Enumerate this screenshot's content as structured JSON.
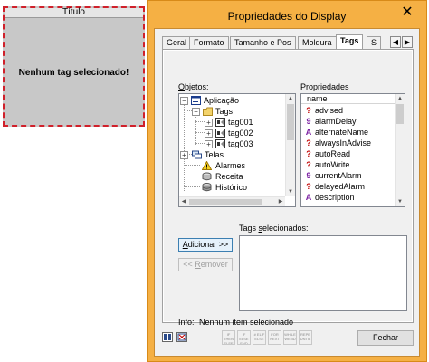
{
  "preview": {
    "title": "Título",
    "message": "Nenhum tag selecionado!"
  },
  "window": {
    "title": "Propriedades do Display",
    "close_glyph": "✕"
  },
  "tabs": [
    {
      "label": "Geral"
    },
    {
      "label": "Formato"
    },
    {
      "label": "Tamanho e Pos"
    },
    {
      "label": "Moldura"
    },
    {
      "label": "Tags"
    },
    {
      "label": "S"
    }
  ],
  "tab_scroll": {
    "left": "◀",
    "right": "▶"
  },
  "objects": {
    "label_prefix": "",
    "label_accel": "O",
    "label_rest": "bjetos:",
    "tree": [
      {
        "text": "Aplicação",
        "icon": "application-icon",
        "expander": "−"
      },
      {
        "text": "Tags",
        "icon": "folder-icon",
        "expander": "−"
      },
      {
        "text": "tag001",
        "icon": "tag-icon",
        "expander": "+"
      },
      {
        "text": "tag002",
        "icon": "tag-icon",
        "expander": "+"
      },
      {
        "text": "tag003",
        "icon": "tag-icon",
        "expander": "+"
      },
      {
        "text": "Telas",
        "icon": "screens-icon",
        "expander": "+"
      },
      {
        "text": "Alarmes",
        "icon": "alarm-icon",
        "expander": ""
      },
      {
        "text": "Receita",
        "icon": "recipe-icon",
        "expander": ""
      },
      {
        "text": "Histórico",
        "icon": "history-icon",
        "expander": ""
      }
    ]
  },
  "properties": {
    "label": "Propriedades",
    "column": "name",
    "items": [
      {
        "name": "advised",
        "icon": "?",
        "color": "#c00000"
      },
      {
        "name": "alarmDelay",
        "icon": "9",
        "color": "#7a1fa2"
      },
      {
        "name": "alternateName",
        "icon": "A",
        "color": "#7a1fa2"
      },
      {
        "name": "alwaysInAdvise",
        "icon": "?",
        "color": "#c00000"
      },
      {
        "name": "autoRead",
        "icon": "?",
        "color": "#c00000"
      },
      {
        "name": "autoWrite",
        "icon": "?",
        "color": "#c00000"
      },
      {
        "name": "currentAlarm",
        "icon": "9",
        "color": "#7a1fa2"
      },
      {
        "name": "delayedAlarm",
        "icon": "?",
        "color": "#c00000"
      },
      {
        "name": "description",
        "icon": "A",
        "color": "#7a1fa2"
      }
    ]
  },
  "selected": {
    "label_prefix": "Tags ",
    "label_accel": "s",
    "label_rest": "elecionados:"
  },
  "buttons": {
    "add_accel": "A",
    "add_rest": "dicionar >>",
    "remove_prefix": "<< ",
    "remove_accel": "R",
    "remove_rest": "emover",
    "close": "Fechar"
  },
  "info": {
    "label": "Info:",
    "value": "Nenhum item selecionado"
  },
  "toolbar": [
    {
      "text": "IF THEN ELSE"
    },
    {
      "text": "IF ELSE END"
    },
    {
      "text": "# ELIF ELSE"
    },
    {
      "text": "FOR NEXT"
    },
    {
      "text": "WHILE WEND"
    },
    {
      "text": "REPE UNTIL"
    }
  ],
  "colors": {
    "window_frame": "#f5b044",
    "preview_border": "#d0202a",
    "preview_bg": "#c8c8c8",
    "bool_icon": "#c00000",
    "value_icon": "#7a1fa2"
  }
}
